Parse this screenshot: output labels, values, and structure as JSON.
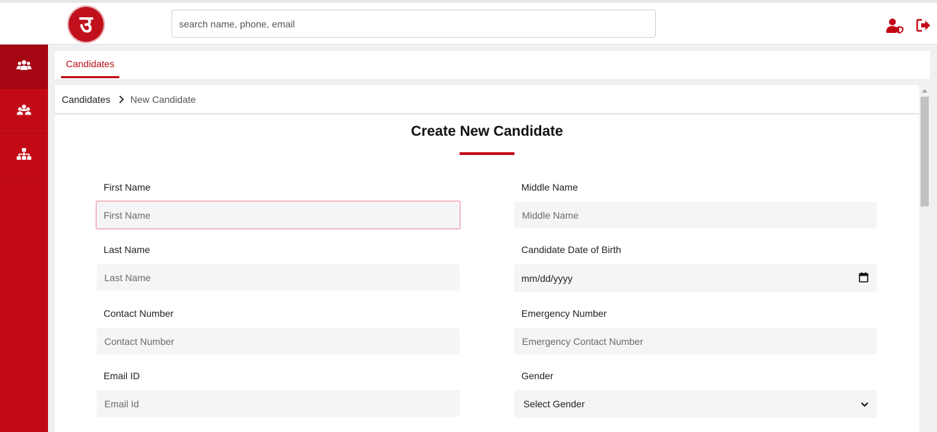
{
  "header": {
    "logo_text": "उ",
    "search_placeholder": "search name, phone, email",
    "user_icon": "user-shield-icon",
    "logout_icon": "sign-out-icon"
  },
  "sidebar": {
    "items": [
      {
        "icon": "users-icon",
        "active": true
      },
      {
        "icon": "user-group-icon",
        "active": false
      },
      {
        "icon": "sitemap-icon",
        "active": false
      }
    ]
  },
  "tabs": [
    {
      "label": "Candidates"
    }
  ],
  "breadcrumb": {
    "parent": "Candidates",
    "current": "New Candidate"
  },
  "form": {
    "title": "Create New Candidate",
    "first_name": {
      "label": "First Name",
      "placeholder": "First Name"
    },
    "middle_name": {
      "label": "Middle Name",
      "placeholder": "Middle Name"
    },
    "last_name": {
      "label": "Last Name",
      "placeholder": "Last Name"
    },
    "dob": {
      "label": "Candidate Date of Birth",
      "value": "mm/dd/yyyy"
    },
    "contact": {
      "label": "Contact Number",
      "placeholder": "Contact Number"
    },
    "emergency": {
      "label": "Emergency Number",
      "placeholder": "Emergency Contact Number"
    },
    "email": {
      "label": "Email ID",
      "placeholder": "Email Id"
    },
    "gender": {
      "label": "Gender",
      "value": "Select Gender"
    }
  },
  "colors": {
    "brand": "#c20a17",
    "input_bg": "#f5f5f8"
  }
}
